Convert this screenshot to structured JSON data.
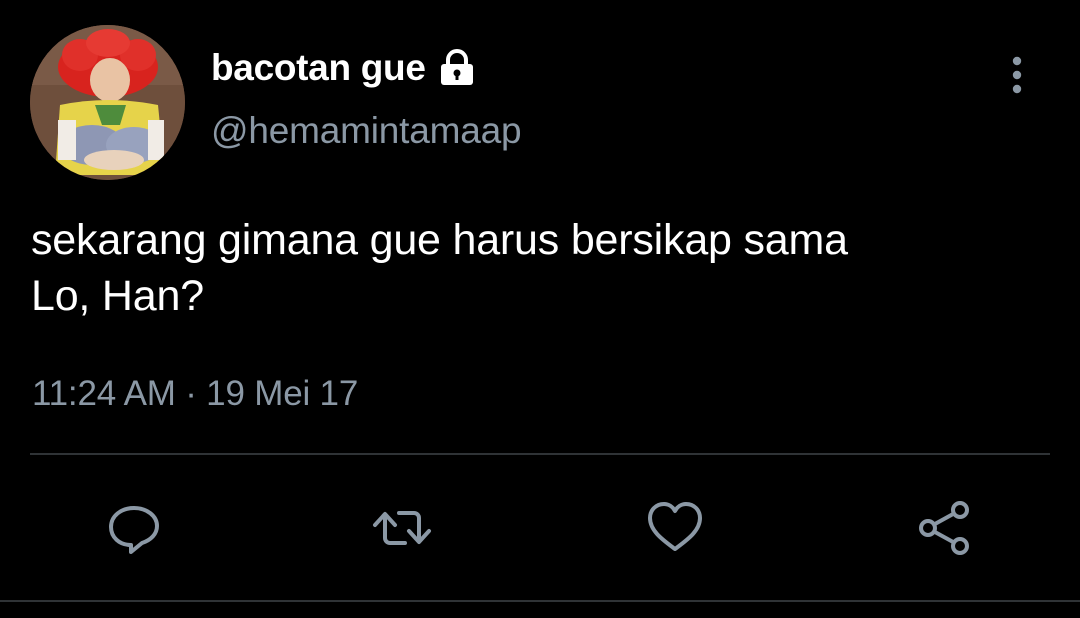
{
  "user": {
    "display_name": "bacotan gue",
    "handle": "@hemamintamaap",
    "protected_icon": "lock-icon"
  },
  "tweet": {
    "text_line1": "sekarang gimana gue harus bersikap sama",
    "text_line2": "Lo, Han?",
    "timestamp": "11:24 AM · 19 Mei 17"
  },
  "actions": {
    "reply_icon": "reply-icon",
    "retweet_icon": "retweet-icon",
    "like_icon": "heart-icon",
    "share_icon": "share-icon"
  },
  "colors": {
    "background": "#000000",
    "primary_text": "#ffffff",
    "secondary_text": "#8b98a5",
    "divider": "#2f3336"
  }
}
